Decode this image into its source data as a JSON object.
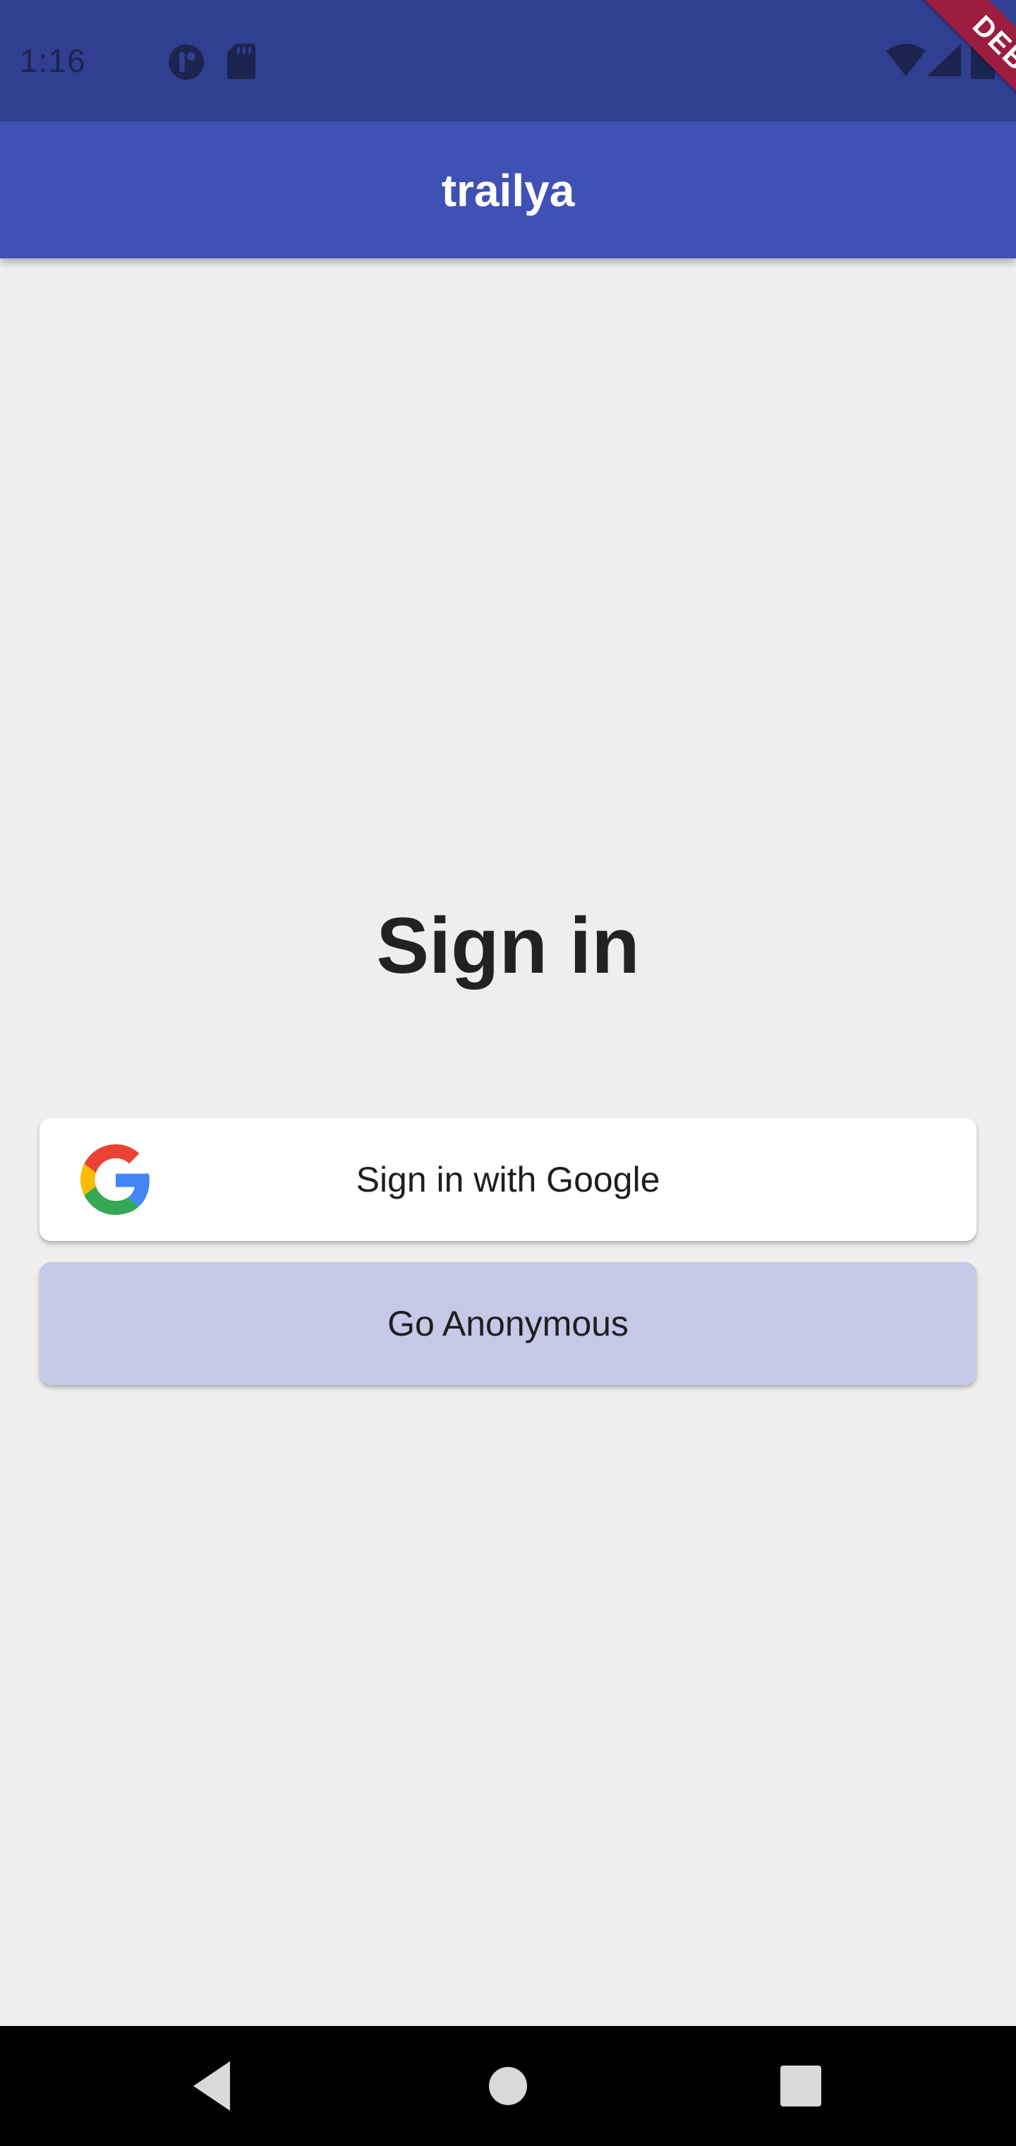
{
  "status_bar": {
    "time": "1:16",
    "icons": [
      "app-notification-icon",
      "sd-card-icon",
      "wifi-icon",
      "cell-signal-icon",
      "battery-icon"
    ]
  },
  "app_bar": {
    "title": "trailya",
    "debug_banner": "DEBUG"
  },
  "main": {
    "heading": "Sign in",
    "google_button_label": "Sign in with Google",
    "anonymous_button_label": "Go Anonymous"
  },
  "navigation": {
    "icons": [
      "back-icon",
      "home-icon",
      "recents-icon"
    ]
  },
  "colors": {
    "status_bar": "#303f8f",
    "app_bar": "#3f51b5",
    "background": "#eeeeee",
    "anonymous_button": "#c5c9e7",
    "debug_banner": "#9c1d3f"
  }
}
